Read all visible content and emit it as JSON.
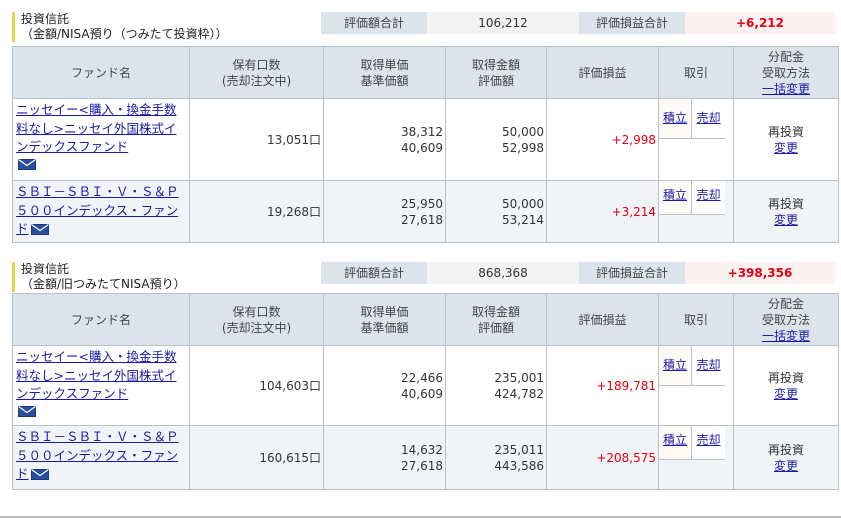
{
  "sections": [
    {
      "title_line1": "投資信託",
      "title_line2": "（金額/NISA預り（つみたて投資枠））",
      "summary": {
        "valuation_label": "評価額合計",
        "valuation_value": "106,212",
        "gain_label": "評価損益合計",
        "gain_value": "+6,212"
      },
      "headers": {
        "fund_name": "ファンド名",
        "units_line1": "保有口数",
        "units_line2": "(売却注文中)",
        "price_line1": "取得単価",
        "price_line2": "基準価額",
        "amount_line1": "取得金額",
        "amount_line2": "評価額",
        "gain": "評価損益",
        "trade": "取引",
        "dist_line1": "分配金",
        "dist_line2": "受取方法",
        "dist_line3": "一括変更"
      },
      "rows": [
        {
          "name": "ニッセイー<購入・換金手数料なし>ニッセイ外国株式インデックスファンド",
          "units": "13,051口",
          "acq_price": "38,312",
          "base_price": "40,609",
          "acq_amount": "50,000",
          "valuation": "52,998",
          "gain": "+2,998",
          "buy": "積立",
          "sell": "売却",
          "dist_method": "再投資",
          "dist_change": "変更"
        },
        {
          "name": "ＳＢＩ－ＳＢＩ・Ｖ・Ｓ＆Ｐ５００インデックス・ファンド",
          "units": "19,268口",
          "acq_price": "25,950",
          "base_price": "27,618",
          "acq_amount": "50,000",
          "valuation": "53,214",
          "gain": "+3,214",
          "buy": "積立",
          "sell": "売却",
          "dist_method": "再投資",
          "dist_change": "変更"
        }
      ]
    },
    {
      "title_line1": "投資信託",
      "title_line2": "（金額/旧つみたてNISA預り）",
      "summary": {
        "valuation_label": "評価額合計",
        "valuation_value": "868,368",
        "gain_label": "評価損益合計",
        "gain_value": "+398,356"
      },
      "headers": {
        "fund_name": "ファンド名",
        "units_line1": "保有口数",
        "units_line2": "(売却注文中)",
        "price_line1": "取得単価",
        "price_line2": "基準価額",
        "amount_line1": "取得金額",
        "amount_line2": "評価額",
        "gain": "評価損益",
        "trade": "取引",
        "dist_line1": "分配金",
        "dist_line2": "受取方法",
        "dist_line3": "一括変更"
      },
      "rows": [
        {
          "name": "ニッセイー<購入・換金手数料なし>ニッセイ外国株式インデックスファンド",
          "units": "104,603口",
          "acq_price": "22,466",
          "base_price": "40,609",
          "acq_amount": "235,001",
          "valuation": "424,782",
          "gain": "+189,781",
          "buy": "積立",
          "sell": "売却",
          "dist_method": "再投資",
          "dist_change": "変更"
        },
        {
          "name": "ＳＢＩ－ＳＢＩ・Ｖ・Ｓ＆Ｐ５００インデックス・ファンド",
          "units": "160,615口",
          "acq_price": "14,632",
          "base_price": "27,618",
          "acq_amount": "235,011",
          "valuation": "443,586",
          "gain": "+208,575",
          "buy": "積立",
          "sell": "売却",
          "dist_method": "再投資",
          "dist_change": "変更"
        }
      ]
    }
  ],
  "icons": {
    "mail": "mail-icon"
  },
  "colors": {
    "gain": "#e60012",
    "link": "#1a1aa6",
    "header_bg": "#dde3ea",
    "title_marker": "#e8d44a"
  }
}
